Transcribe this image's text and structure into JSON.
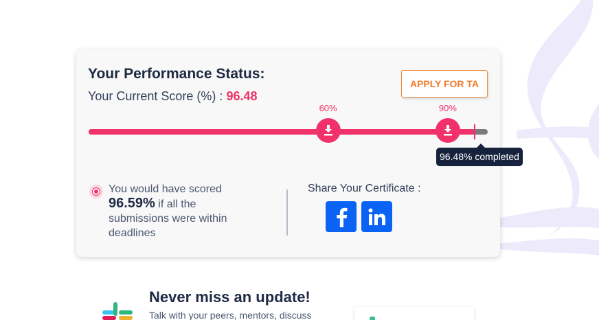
{
  "performance": {
    "title": "Your Performance Status:",
    "score_label": "Your Current Score (%) :",
    "score_value": "96.48",
    "apply_button": "APPLY FOR TA",
    "progress_percent": 96.48,
    "milestones": [
      {
        "label": "60%",
        "value": 60,
        "icon": "download-icon"
      },
      {
        "label": "90%",
        "value": 90,
        "icon": "download-icon"
      }
    ],
    "completed_tooltip": "96.48% completed"
  },
  "projection": {
    "prefix": "You would have scored",
    "value": "96.59%",
    "suffix": "if all the submissions were within deadlines"
  },
  "share": {
    "label": "Share Your Certificate :",
    "buttons": [
      {
        "icon": "facebook-icon",
        "color": "#0a63f5"
      },
      {
        "icon": "linkedin-icon",
        "color": "#0a63f5"
      }
    ]
  },
  "slack_promo": {
    "icon": "slack-logo-icon",
    "title": "Never miss an update!",
    "subtitle": "Talk with your peers, mentors, discuss"
  },
  "colors": {
    "accent": "#f0316a",
    "apply_orange": "#f07b2a",
    "tooltip_bg": "#17233d",
    "share_blue": "#0a63f5",
    "deco_lavender": "#eceafb"
  }
}
